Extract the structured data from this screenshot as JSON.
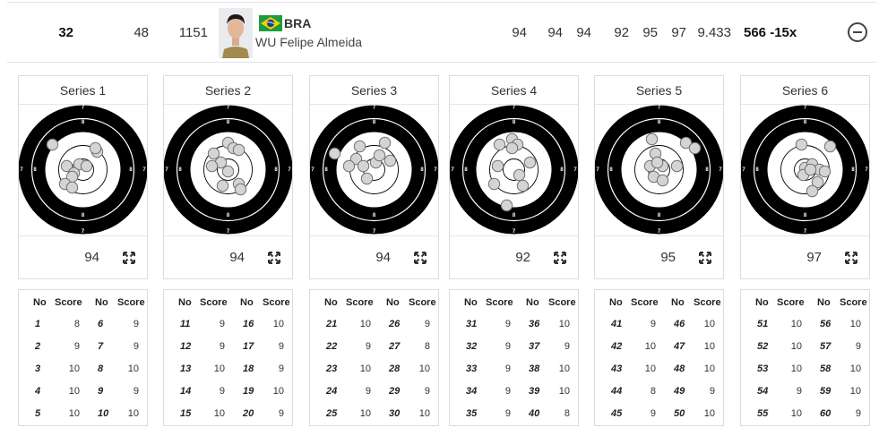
{
  "athlete_row": {
    "rank": "32",
    "bib": "48",
    "value": "1151",
    "noc": "BRA",
    "name": "WU Felipe Almeida",
    "series_scores": [
      "94",
      "94",
      "94",
      "92",
      "95",
      "97"
    ],
    "avg": "9.433",
    "total": "566 -15x",
    "flag_colors": {
      "green": "#1f9b3f",
      "yellow": "#f4d100",
      "blue": "#1e3f8f"
    }
  },
  "target": {
    "ring_labels": [
      "7",
      "8"
    ],
    "shot_color": "#d4d4d4",
    "black": "#000000"
  },
  "table_headers": {
    "no": "No",
    "score": "Score"
  },
  "series": [
    {
      "title": "Series 1",
      "score": "94",
      "shots": [
        {
          "no": "1",
          "score": "8"
        },
        {
          "no": "2",
          "score": "9"
        },
        {
          "no": "3",
          "score": "10"
        },
        {
          "no": "4",
          "score": "10"
        },
        {
          "no": "5",
          "score": "10"
        },
        {
          "no": "6",
          "score": "9"
        },
        {
          "no": "7",
          "score": "9"
        },
        {
          "no": "8",
          "score": "10"
        },
        {
          "no": "9",
          "score": "9"
        },
        {
          "no": "10",
          "score": "10"
        }
      ]
    },
    {
      "title": "Series 2",
      "score": "94",
      "shots": [
        {
          "no": "11",
          "score": "9"
        },
        {
          "no": "12",
          "score": "9"
        },
        {
          "no": "13",
          "score": "10"
        },
        {
          "no": "14",
          "score": "9"
        },
        {
          "no": "15",
          "score": "10"
        },
        {
          "no": "16",
          "score": "10"
        },
        {
          "no": "17",
          "score": "9"
        },
        {
          "no": "18",
          "score": "9"
        },
        {
          "no": "19",
          "score": "10"
        },
        {
          "no": "20",
          "score": "9"
        }
      ]
    },
    {
      "title": "Series 3",
      "score": "94",
      "shots": [
        {
          "no": "21",
          "score": "10"
        },
        {
          "no": "22",
          "score": "9"
        },
        {
          "no": "23",
          "score": "10"
        },
        {
          "no": "24",
          "score": "9"
        },
        {
          "no": "25",
          "score": "10"
        },
        {
          "no": "26",
          "score": "9"
        },
        {
          "no": "27",
          "score": "8"
        },
        {
          "no": "28",
          "score": "10"
        },
        {
          "no": "29",
          "score": "9"
        },
        {
          "no": "30",
          "score": "10"
        }
      ]
    },
    {
      "title": "Series 4",
      "score": "92",
      "shots": [
        {
          "no": "31",
          "score": "9"
        },
        {
          "no": "32",
          "score": "9"
        },
        {
          "no": "33",
          "score": "9"
        },
        {
          "no": "34",
          "score": "9"
        },
        {
          "no": "35",
          "score": "9"
        },
        {
          "no": "36",
          "score": "10"
        },
        {
          "no": "37",
          "score": "9"
        },
        {
          "no": "38",
          "score": "10"
        },
        {
          "no": "39",
          "score": "10"
        },
        {
          "no": "40",
          "score": "8"
        }
      ]
    },
    {
      "title": "Series 5",
      "score": "95",
      "shots": [
        {
          "no": "41",
          "score": "9"
        },
        {
          "no": "42",
          "score": "10"
        },
        {
          "no": "43",
          "score": "10"
        },
        {
          "no": "44",
          "score": "8"
        },
        {
          "no": "45",
          "score": "9"
        },
        {
          "no": "46",
          "score": "10"
        },
        {
          "no": "47",
          "score": "10"
        },
        {
          "no": "48",
          "score": "10"
        },
        {
          "no": "49",
          "score": "9"
        },
        {
          "no": "50",
          "score": "10"
        }
      ]
    },
    {
      "title": "Series 6",
      "score": "97",
      "shots": [
        {
          "no": "51",
          "score": "10"
        },
        {
          "no": "52",
          "score": "10"
        },
        {
          "no": "53",
          "score": "10"
        },
        {
          "no": "54",
          "score": "9"
        },
        {
          "no": "55",
          "score": "10"
        },
        {
          "no": "56",
          "score": "10"
        },
        {
          "no": "57",
          "score": "9"
        },
        {
          "no": "58",
          "score": "10"
        },
        {
          "no": "59",
          "score": "10"
        },
        {
          "no": "60",
          "score": "9"
        }
      ]
    }
  ]
}
